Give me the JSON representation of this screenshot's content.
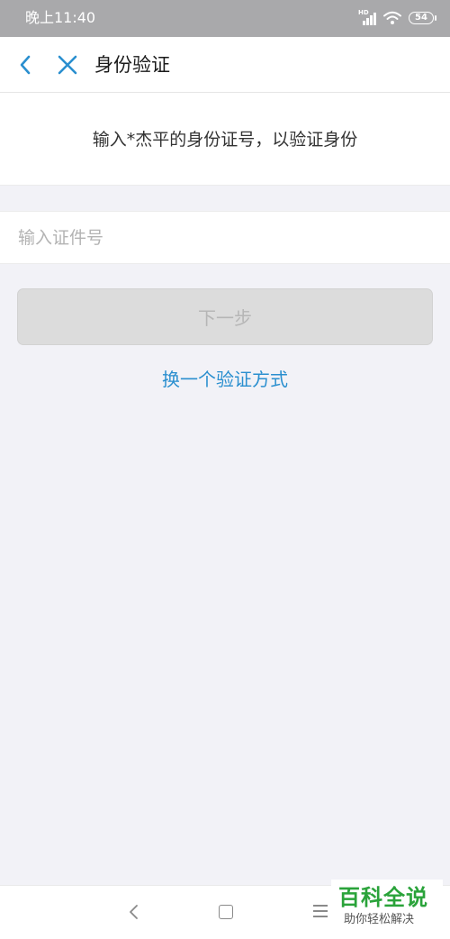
{
  "status_bar": {
    "time": "晚上11:40",
    "network_label": "HD",
    "battery": "54"
  },
  "nav": {
    "title": "身份验证"
  },
  "prompt": {
    "text": "输入*杰平的身份证号，以验证身份"
  },
  "id_input": {
    "value": "",
    "placeholder": "输入证件号"
  },
  "next_button": {
    "label": "下一步"
  },
  "switch_method": {
    "label": "换一个验证方式"
  },
  "watermark": {
    "main": "百科全说",
    "sub": "助你轻松解决"
  },
  "colors": {
    "accent_blue": "#2a8fcf",
    "disabled_button": "#dcdcdc",
    "watermark_green": "#2aa33a"
  }
}
